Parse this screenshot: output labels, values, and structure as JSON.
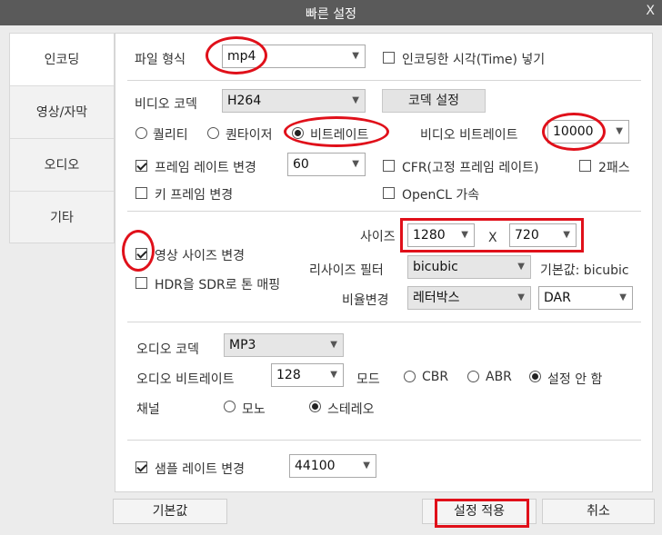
{
  "window": {
    "title": "빠른 설정",
    "close": "X"
  },
  "sidebar": {
    "items": [
      "인코딩",
      "영상/자막",
      "오디오",
      "기타"
    ]
  },
  "format": {
    "label": "파일 형식",
    "value": "mp4",
    "insert_time_label": "인코딩한 시각(Time) 넣기",
    "insert_time_checked": false
  },
  "video": {
    "codec_label": "비디오 코덱",
    "codec_value": "H264",
    "codec_settings_button": "코덱 설정",
    "mode_options": [
      "퀄리티",
      "퀀타이저",
      "비트레이트"
    ],
    "selected_mode": "비트레이트",
    "bitrate_label": "비디오 비트레이트",
    "bitrate_value": "10000",
    "framerate_change_label": "프레임 레이트 변경",
    "framerate_change_checked": true,
    "framerate_value": "60",
    "cfr_label": "CFR(고정 프레임 레이트)",
    "cfr_checked": false,
    "twopass_label": "2패스",
    "twopass_checked": false,
    "keyframe_label": "키 프레임 변경",
    "keyframe_checked": false,
    "opencl_label": "OpenCL 가속",
    "opencl_checked": false
  },
  "resize": {
    "change_size_label": "영상 사이즈 변경",
    "change_size_checked": true,
    "hdr_label": "HDR을 SDR로 톤 매핑",
    "hdr_checked": false,
    "size_label": "사이즈",
    "width": "1280",
    "x_sep": "X",
    "height": "720",
    "filter_label": "리사이즈 필터",
    "filter_value": "bicubic",
    "filter_default": "기본값: bicubic",
    "aspect_label": "비율변경",
    "aspect_value": "레터박스",
    "aspect_mode": "DAR"
  },
  "audio": {
    "codec_label": "오디오 코덱",
    "codec_value": "MP3",
    "bitrate_label": "오디오 비트레이트",
    "bitrate_value": "128",
    "mode_label": "모드",
    "mode_options": [
      "CBR",
      "ABR",
      "설정 안 함"
    ],
    "selected_mode": "설정 안 함",
    "channel_label": "채널",
    "channel_options": [
      "모노",
      "스테레오"
    ],
    "selected_channel": "스테레오",
    "samplerate_label": "샘플 레이트 변경",
    "samplerate_checked": true,
    "samplerate_value": "44100"
  },
  "footer": {
    "default_button": "기본값",
    "apply_button": "설정 적용",
    "cancel_button": "취소"
  },
  "colors": {
    "highlight": "#e0101a",
    "titlebar": "#5a5a5a"
  }
}
